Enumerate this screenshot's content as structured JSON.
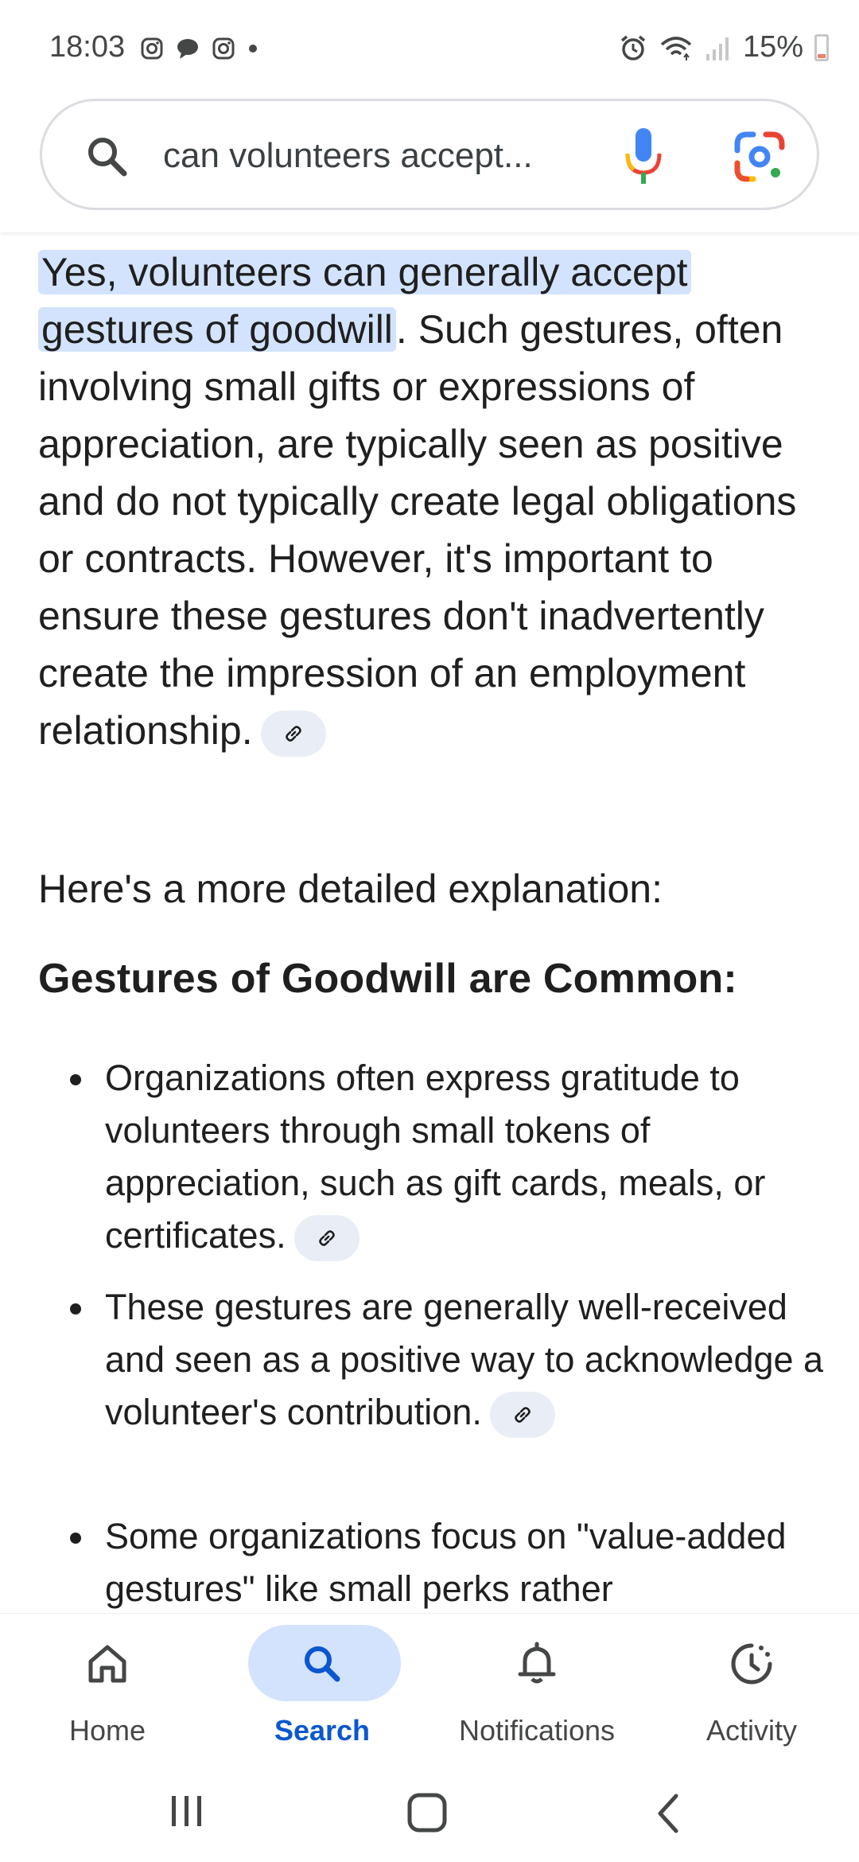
{
  "status_bar": {
    "time": "18:03",
    "left_icons": [
      "instagram-icon",
      "chat-icon",
      "instagram-icon",
      "dot-icon"
    ],
    "right_icons": [
      "alarm-icon",
      "wifi-icon",
      "signal-icon"
    ],
    "battery_text": "15%"
  },
  "search": {
    "query": "can volunteers accept..."
  },
  "answer": {
    "highlight": "Yes, volunteers can generally accept gestures of goodwill",
    "body": ". Such gestures, often involving small gifts or expressions of appreciation, are typically seen as positive and do not typically create legal obligations or contracts. However, it's important to ensure these gestures don't inadvertently create the impression of an employment relationship.",
    "more": "Here's a more detailed explanation:",
    "heading": "Gestures of Goodwill are Common:",
    "bullets": [
      "Organizations often express gratitude to volunteers through small tokens of appreciation, such as gift cards, meals, or certificates.",
      "These gestures are generally well-received and seen as a positive way to acknowledge a volunteer's contribution.",
      "Some organizations focus on \"value-added gestures\" like small perks rather"
    ]
  },
  "bottom_nav": {
    "items": [
      {
        "label": "Home",
        "icon": "home-icon",
        "active": false
      },
      {
        "label": "Search",
        "icon": "search-icon",
        "active": true
      },
      {
        "label": "Notifications",
        "icon": "bell-icon",
        "active": false
      },
      {
        "label": "Activity",
        "icon": "activity-icon",
        "active": false
      }
    ]
  },
  "colors": {
    "accent": "#0b57d0",
    "highlight": "#d3e3fd",
    "chip": "#e9eef6",
    "text": "#1f1f1f"
  }
}
